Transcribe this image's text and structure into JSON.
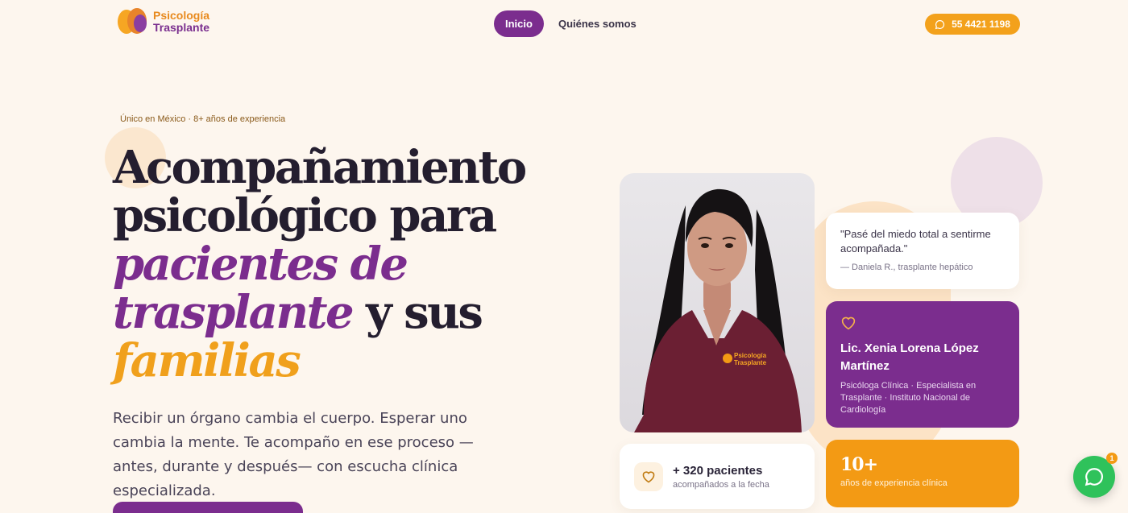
{
  "header": {
    "logo_line1": "Psicología",
    "logo_line2": "Trasplante",
    "nav": [
      {
        "label": "Inicio",
        "active": true
      },
      {
        "label": "Quiénes somos",
        "active": false
      }
    ],
    "phone": "55 4421 1198"
  },
  "hero": {
    "eyebrow": "Único en México · 8+ años de experiencia",
    "headline_line1": "Acompañamiento",
    "headline_line2": "psicológico para",
    "headline_line3": "pacientes de",
    "headline_line4_em": "trasplante",
    "headline_line4_rest": " y sus",
    "headline_line5": "familias",
    "lead": "Recibir un órgano cambia el cuerpo. Esperar uno cambia la mente. Te acompaño en ese proceso — antes, durante y después— con escucha clínica especializada."
  },
  "portrait": {
    "scrub_text_line1": "Psicología",
    "scrub_text_line2": "Trasplante"
  },
  "testimonial": {
    "quote": "\"Pasé del miedo total a sentirme acompañada.\"",
    "author": "— Daniela R., trasplante hepático"
  },
  "profile": {
    "name": "Lic. Xenia Lorena López Martínez",
    "role": "Psicóloga Clínica · Especialista en Trasplante · Instituto Nacional de Cardiología"
  },
  "stats": {
    "patients_value": "+ 320 pacientes",
    "patients_label": "acompañados a la fecha",
    "years_value": "10+",
    "years_label": "años de experiencia clínica"
  },
  "whatsapp": {
    "badge": "1"
  },
  "colors": {
    "background": "#fdf6ee",
    "purple": "#7b2d8e",
    "orange": "#f39a14",
    "whatsapp_green": "#2fc25b"
  }
}
